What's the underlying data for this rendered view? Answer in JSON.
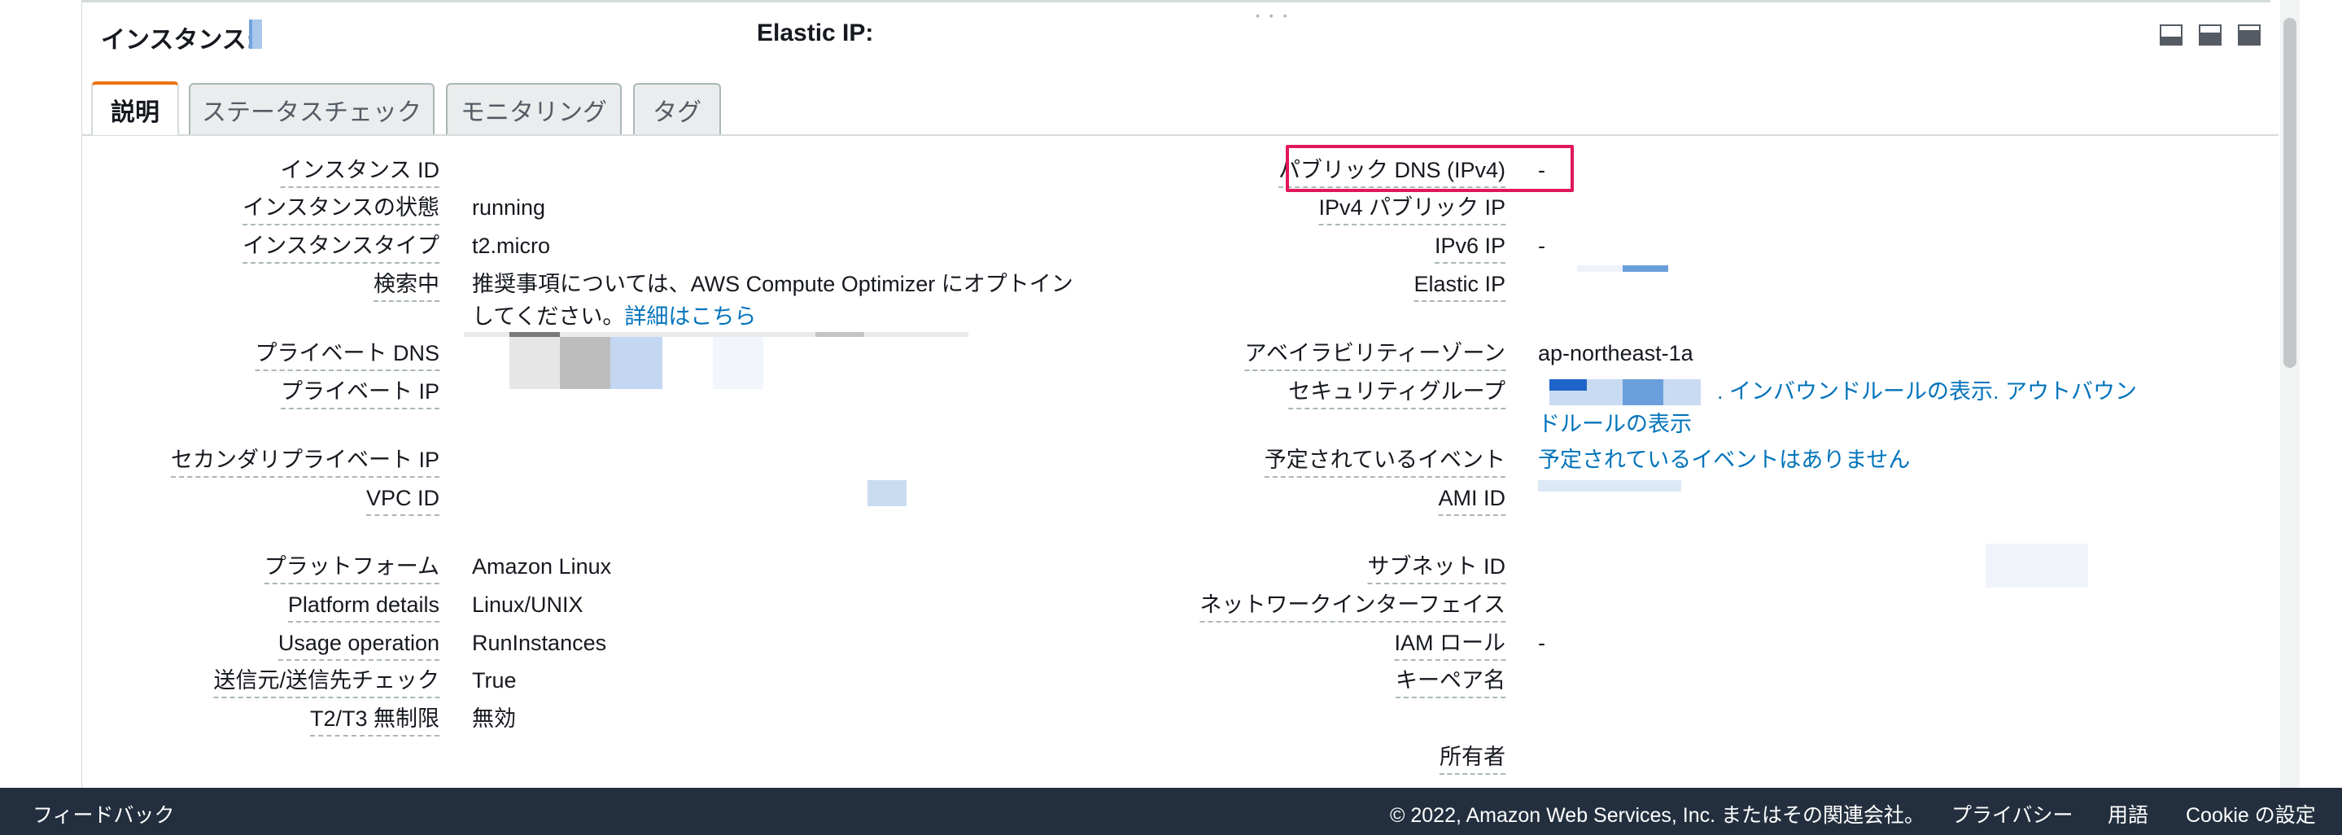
{
  "header": {
    "instance_label": "インスタンス:",
    "elastic_ip_label": "Elastic IP:",
    "layout_icons": [
      "layout-bottom-icon",
      "layout-split-icon",
      "layout-full-icon"
    ]
  },
  "tabs": [
    {
      "label": "説明",
      "active": true
    },
    {
      "label": "ステータスチェック",
      "active": false
    },
    {
      "label": "モニタリング",
      "active": false
    },
    {
      "label": "タグ",
      "active": false
    }
  ],
  "left_fields": [
    {
      "label": "インスタンス ID",
      "value": ""
    },
    {
      "label": "インスタンスの状態",
      "value": "running"
    },
    {
      "label": "インスタンスタイプ",
      "value": "t2.micro"
    },
    {
      "label": "検索中",
      "value_line1": "推奨事項については、AWS Compute Optimizer にオプトイン",
      "value_line2": "してください。",
      "link": "詳細はこちら"
    },
    {
      "label": "プライベート DNS",
      "value": ""
    },
    {
      "label": "プライベート IP",
      "value": ""
    },
    {
      "label": "セカンダリプライベート IP",
      "value": ""
    },
    {
      "label": "VPC ID",
      "value": ""
    },
    {
      "label": "プラットフォーム",
      "value": "Amazon Linux"
    },
    {
      "label": "Platform details",
      "value": "Linux/UNIX"
    },
    {
      "label": "Usage operation",
      "value": "RunInstances"
    },
    {
      "label": "送信元/送信先チェック",
      "value": "True"
    },
    {
      "label": "T2/T3 無制限",
      "value": "無効"
    }
  ],
  "right_fields": [
    {
      "label": "パブリック DNS (IPv4)",
      "value": "-"
    },
    {
      "label": "IPv4 パブリック IP",
      "value": ""
    },
    {
      "label": "IPv6 IP",
      "value": "-"
    },
    {
      "label": "Elastic IP",
      "value": ""
    },
    {
      "label": "アベイラビリティーゾーン",
      "value": "ap-northeast-1a"
    },
    {
      "label": "セキュリティグループ",
      "link_line1": ". インバウンドルールの表示. アウトバウン",
      "link_line2": "ドルールの表示"
    },
    {
      "label": "予定されているイベント",
      "link": "予定されているイベントはありません"
    },
    {
      "label": "AMI ID",
      "value": ""
    },
    {
      "label": "サブネット ID",
      "value": ""
    },
    {
      "label": "ネットワークインターフェイス",
      "value": ""
    },
    {
      "label": "IAM ロール",
      "value": "-"
    },
    {
      "label": "キーペア名",
      "value": ""
    },
    {
      "label": "所有者",
      "value": ""
    }
  ],
  "footer": {
    "feedback": "フィードバック",
    "copyright": "© 2022, Amazon Web Services, Inc. またはその関連会社。",
    "privacy": "プライバシー",
    "terms": "用語",
    "cookies": "Cookie の設定"
  },
  "colors": {
    "link": "#0073bb",
    "highlight": "#e0185a",
    "footer_bg": "#232f3e",
    "tab_active_accent": "#ec7211"
  }
}
